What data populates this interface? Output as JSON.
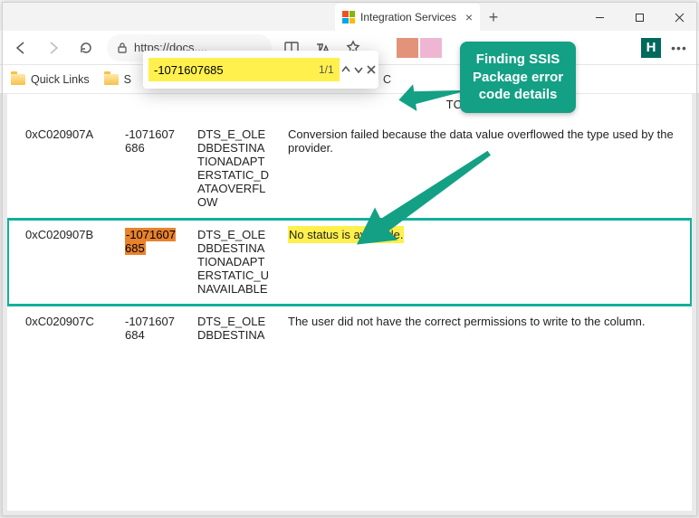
{
  "window": {
    "tab_title": "Integration Services",
    "address": "https://docs....",
    "colors": {
      "swatch1": "#b9a0d8",
      "swatch2": "#e2937a",
      "swatch3": "#efb6d3"
    }
  },
  "bookmarks": {
    "item1": "Quick Links",
    "item2_prefix": "S",
    "item3_prefix": "C"
  },
  "find": {
    "query": "-1071607685",
    "count": "1/1"
  },
  "callout": {
    "line1": "Finding SSIS",
    "line2": "Package error",
    "line3": "code details"
  },
  "table": {
    "frag_top": "TCH",
    "rows": [
      {
        "hex": "0xC020907A",
        "dec": "-1071607686",
        "name": "DTS_E_OLEDBDESTINATIONADAPTERSTATIC_DATAOVERFLOW",
        "desc": "Conversion failed because the data value overflowed the type used by the provider."
      },
      {
        "hex": "0xC020907B",
        "dec": "-1071607685",
        "name": "DTS_E_OLEDBDESTINATIONADAPTERSTATIC_UNAVAILABLE",
        "desc": "No status is available.",
        "highlighted": true
      },
      {
        "hex": "0xC020907C",
        "dec": "-1071607684",
        "name": "DTS_E_OLEDBDESTINA",
        "desc": "The user did not have the correct permissions to write to the column."
      }
    ]
  }
}
